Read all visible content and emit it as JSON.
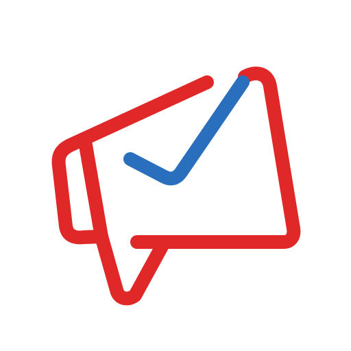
{
  "logo": {
    "name": "megaphone-mail-check-logo",
    "icon": "megaphone-check-icon",
    "colors": {
      "background": "#ffffff",
      "outline": "#e02828",
      "check": "#2a6fbd"
    }
  }
}
